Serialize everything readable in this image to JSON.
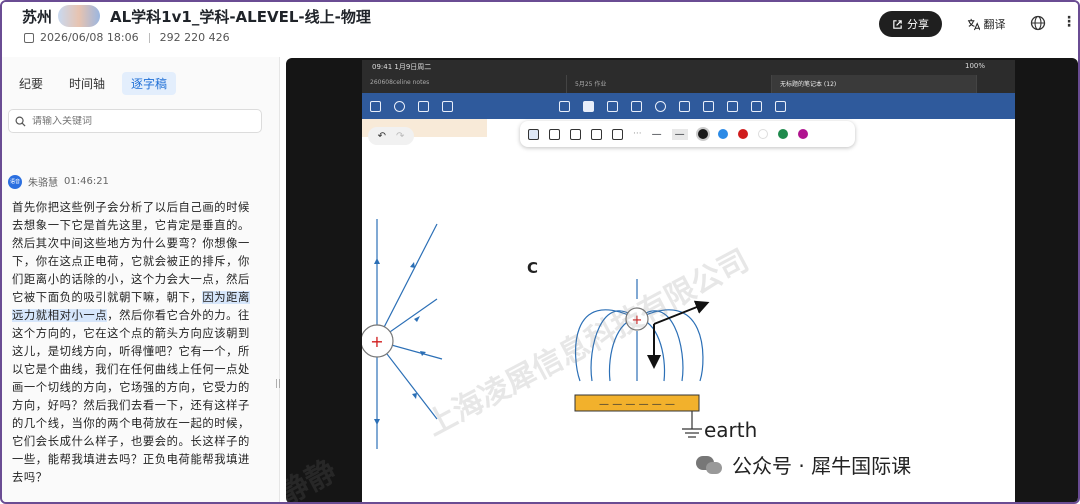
{
  "header": {
    "city": "苏州",
    "title": "AL学科1v1_学科-ALEVEL-线上-物理",
    "date": "2026/06/08 18:06",
    "meeting_id": "292 220 426",
    "share_label": "分享",
    "translate_label": "翻译"
  },
  "left_panel": {
    "tabs": [
      {
        "label": "纪要"
      },
      {
        "label": "时间轴"
      },
      {
        "label": "逐字稿"
      }
    ],
    "search_placeholder": "请输入关键词",
    "speaker_badge": "语音",
    "speaker_name": "朱骆慧",
    "speaker_time": "01:46:21",
    "transcript_part1": "首先你把这些例子会分析了以后自己画的时候去想象一下它是首先这里，它肯定是垂直的。然后其次中间这些地方为什么要弯？你想像一下，你在这点正电荷，它就会被正的排斥，你们距离小的话除的小，这个力会大一点，然后它被下面负的吸引就朝下嘛，朝下，",
    "transcript_highlight": "因为距离远力就相对小一点",
    "transcript_part2": "，然后你看它合外的力。往这个方向的，它在这个点的箭头方向应该朝到这儿，是切线方向，听得懂吧？它有一个，所以它是个曲线，我们在任何曲线上任何一点处画一个切线的方向，它场强的方向，它受力的方向，好吗？然后我们去看一下，还有这样子的几个线，当你的两个电荷放在一起的时候，它们会长成什么样子，也要会的。长这样子的一些，能帮我填进去吗？正负电荷能帮我填进去吗？"
  },
  "ipad": {
    "time": "09:41  1月9日周二",
    "battery": "100%",
    "tabs": [
      {
        "label": "260608celine notes"
      },
      {
        "label": "5月25 作业"
      },
      {
        "label": "无标题的笔记本 (12)"
      }
    ],
    "diagram_label": "C",
    "earth_label": "earth",
    "plus_sign": "+",
    "minus_signs": "— — — — — —",
    "colors": [
      "#1a1a1a",
      "#2b8ae6",
      "#d01c1c",
      "#ffffff",
      "#1f8a4c",
      "#b0138f"
    ]
  },
  "watermark": {
    "company": "上海凌犀信息科技有限公司",
    "name": "静静"
  },
  "brand": {
    "text": "公众号 · 犀牛国际课"
  }
}
